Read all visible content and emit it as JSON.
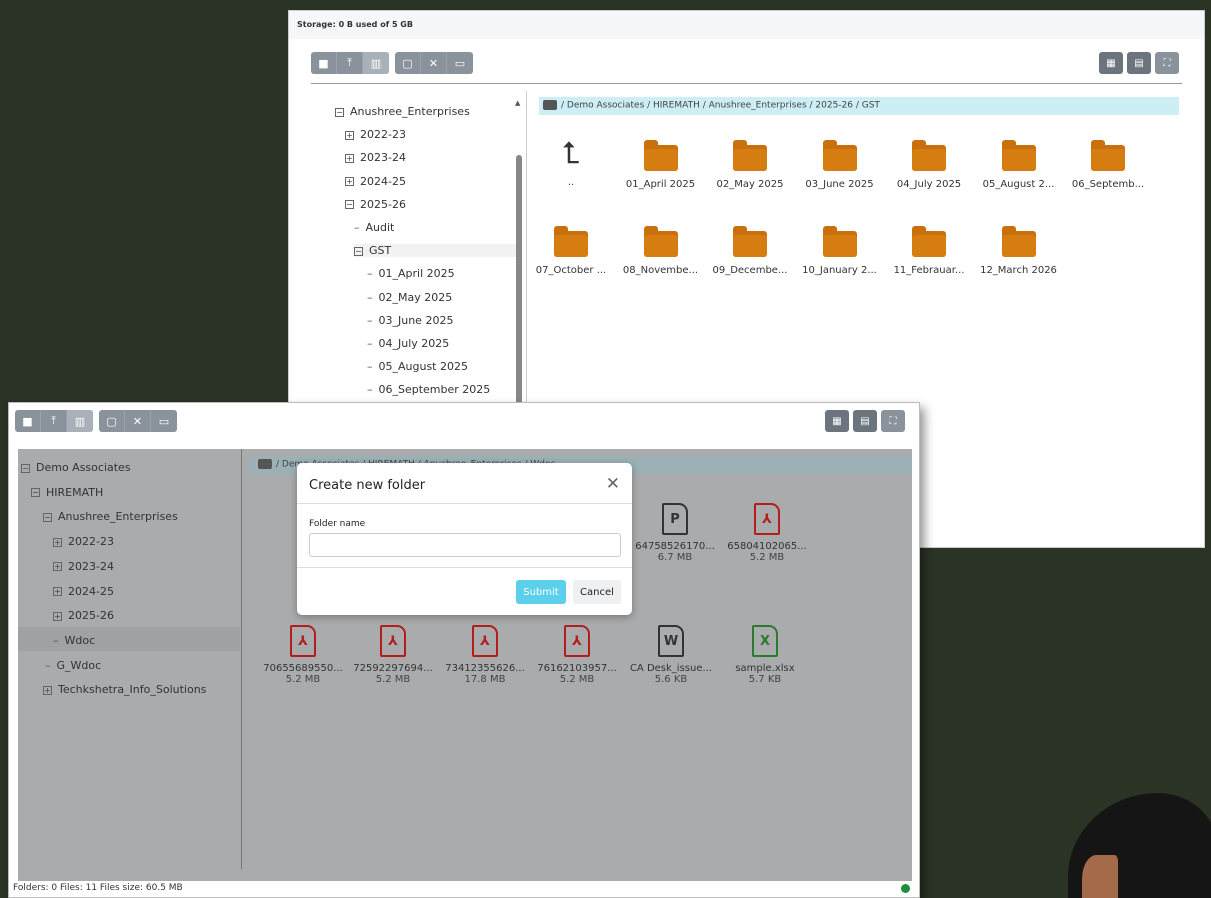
{
  "back_window": {
    "storage": "Storage: 0 B used of 5 GB",
    "tree": [
      {
        "label": "Anushree_Enterprises",
        "marker": "minus"
      },
      {
        "label": "2022-23",
        "marker": "plus"
      },
      {
        "label": "2023-24",
        "marker": "plus"
      },
      {
        "label": "2024-25",
        "marker": "plus"
      },
      {
        "label": "2025-26",
        "marker": "minus"
      },
      {
        "label": "Audit",
        "marker": "dash"
      },
      {
        "label": "GST",
        "marker": "minus"
      },
      {
        "label": "01_April 2025",
        "marker": "dash"
      },
      {
        "label": "02_May 2025",
        "marker": "dash"
      },
      {
        "label": "03_June 2025",
        "marker": "dash"
      },
      {
        "label": "04_July 2025",
        "marker": "dash"
      },
      {
        "label": "05_August 2025",
        "marker": "dash"
      },
      {
        "label": "06_September 2025",
        "marker": "dash"
      }
    ],
    "breadcrumb": "/ Demo Associates / HIREMATH / Anushree_Enterprises / 2025-26 / GST",
    "up_label": "..",
    "folders": [
      "01_April 2025",
      "02_May 2025",
      "03_June 2025",
      "04_July 2025",
      "05_August 2...",
      "06_Septemb...",
      "07_October ...",
      "08_Novembe...",
      "09_Decembe...",
      "10_January 2...",
      "11_Febrauar...",
      "12_March 2026"
    ]
  },
  "front_window": {
    "tree": [
      {
        "label": "Demo Associates",
        "marker": "minus"
      },
      {
        "label": "HIREMATH",
        "marker": "minus"
      },
      {
        "label": "Anushree_Enterprises",
        "marker": "minus"
      },
      {
        "label": "2022-23",
        "marker": "plus"
      },
      {
        "label": "2023-24",
        "marker": "plus"
      },
      {
        "label": "2024-25",
        "marker": "plus"
      },
      {
        "label": "2025-26",
        "marker": "plus"
      },
      {
        "label": "Wdoc",
        "marker": "dash"
      },
      {
        "label": "G_Wdoc",
        "marker": "dash"
      },
      {
        "label": "Techkshetra_Info_Solutions",
        "marker": "plus"
      }
    ],
    "breadcrumb": "/ Demo Associates / HIREMATH / Anushree_Enterprises / Wdoc",
    "up_label": "..",
    "files": [
      {
        "name": "64758526170...",
        "size": "6.7 MB",
        "type": "ppt"
      },
      {
        "name": "65804102065...",
        "size": "5.2 MB",
        "type": "pdf"
      },
      {
        "name": "70655689550...",
        "size": "5.2 MB",
        "type": "pdf"
      },
      {
        "name": "72592297694...",
        "size": "5.2 MB",
        "type": "pdf"
      },
      {
        "name": "73412355626...",
        "size": "17.8 MB",
        "type": "pdf"
      },
      {
        "name": "76162103957...",
        "size": "5.2 MB",
        "type": "pdf"
      },
      {
        "name": "CA Desk_issue...",
        "size": "5.6 KB",
        "type": "word"
      },
      {
        "name": "sample.xlsx",
        "size": "5.7 KB",
        "type": "xls"
      }
    ],
    "status": "Folders: 0 Files: 11 Files size: 60.5 MB"
  },
  "modal": {
    "title": "Create new folder",
    "field_label": "Folder name",
    "field_value": "",
    "submit_label": "Submit",
    "cancel_label": "Cancel",
    "close_glyph": "✕"
  },
  "icons": {
    "ppt": "P",
    "pdf": "⅄",
    "word": "W",
    "xls": "X"
  },
  "colors": {
    "folder": "#d67d12",
    "pdf": "#b31d1d",
    "xls": "#2c7a2c",
    "submit": "#5ccfea",
    "breadcrumb_bg": "#cdeef5"
  }
}
